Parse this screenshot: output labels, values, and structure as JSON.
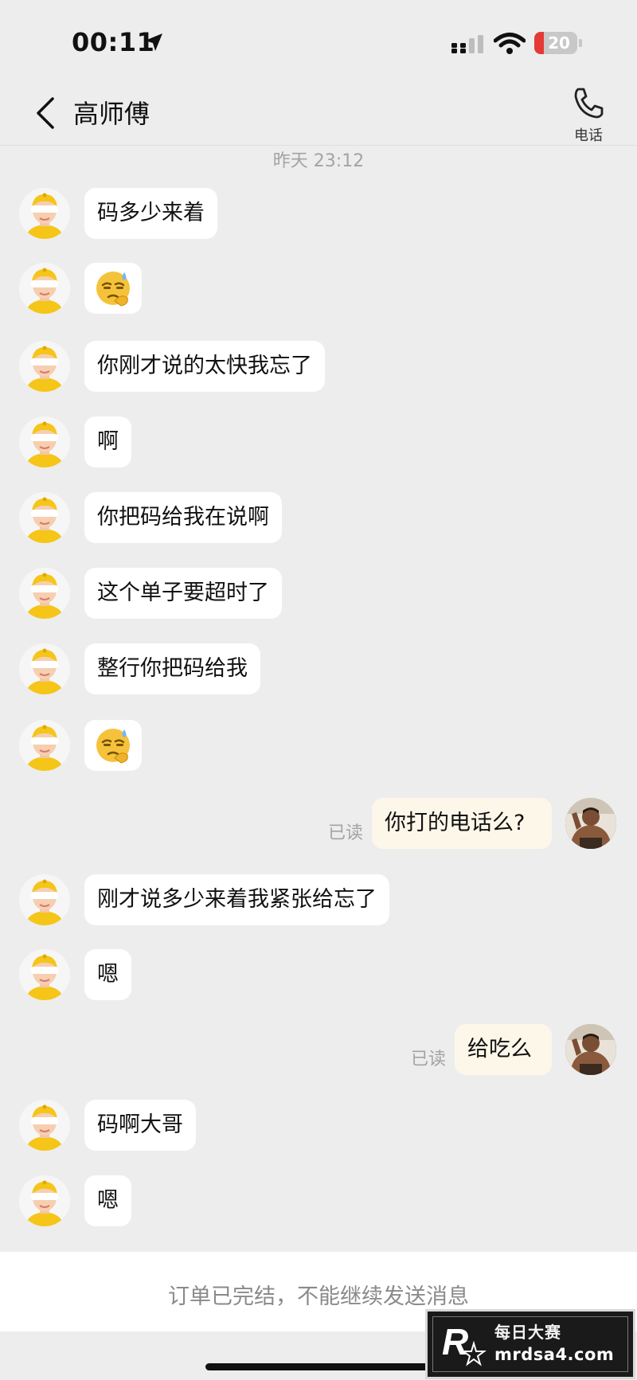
{
  "status_bar": {
    "time": "00:11",
    "battery": "20"
  },
  "header": {
    "title": "高师傅",
    "call_label": "电话"
  },
  "timestamp": "昨天 23:12",
  "messages": [
    {
      "side": "left",
      "text": "码多少来着"
    },
    {
      "side": "left",
      "emoji": "sweat-squint-emoji"
    },
    {
      "side": "left",
      "text": "你刚才说的太快我忘了"
    },
    {
      "side": "left",
      "text": "啊"
    },
    {
      "side": "left",
      "text": "你把码给我在说啊"
    },
    {
      "side": "left",
      "text": "这个单子要超时了"
    },
    {
      "side": "left",
      "text": "整行你把码给我"
    },
    {
      "side": "left",
      "emoji": "sweat-squint-emoji"
    },
    {
      "side": "right",
      "text": "你打的电话么?",
      "status": "已读"
    },
    {
      "side": "left",
      "text": "刚才说多少来着我紧张给忘了"
    },
    {
      "side": "left",
      "text": "嗯"
    },
    {
      "side": "right",
      "text": "给吃么",
      "status": "已读"
    },
    {
      "side": "left",
      "text": "码啊大哥"
    },
    {
      "side": "left",
      "text": "嗯"
    }
  ],
  "footer": {
    "notice": "订单已完结，不能继续发送消息"
  },
  "watermark": {
    "brand": "每日大赛",
    "url": "mrdsa4.com",
    "logo_letter": "R"
  },
  "colors": {
    "background": "#ededed",
    "incoming_bubble": "#ffffff",
    "outgoing_bubble": "#fdf7e9",
    "avatar_accent": "#f5c518",
    "battery_low": "#e53935"
  }
}
